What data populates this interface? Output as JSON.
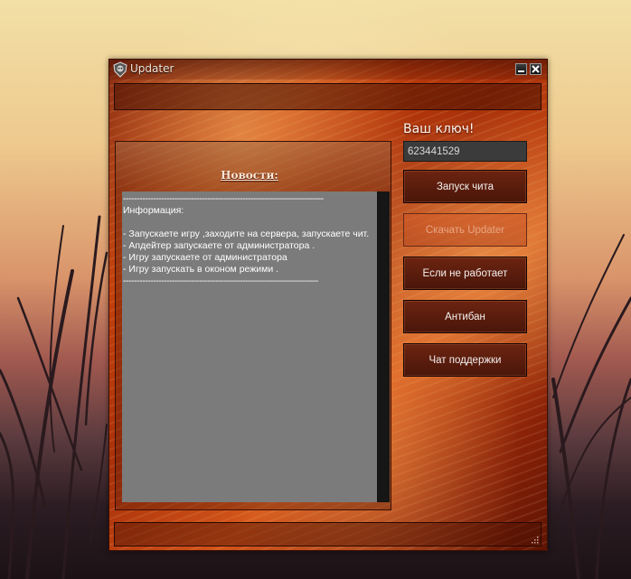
{
  "window": {
    "title": "Updater"
  },
  "news": {
    "title": "Новости:",
    "lines": [
      "--------------------------------------------------------------------------",
      "Информация:",
      "",
      "- Запускаете игру ,заходите на сервера, запускаете чит.",
      "- Апдейтер запускаете от администратора .",
      "- Игру запускаете от администратора",
      "- Игру запускать в оконом режими .",
      " ------------------------------------------------------------------------"
    ]
  },
  "key": {
    "label": "Ваш ключ!",
    "value": "623441529"
  },
  "buttons": {
    "launch_cheat": "Запуск чита",
    "download_updater": "Скачать Updater",
    "not_working": "Если не работает",
    "antiban": "Антибан",
    "support_chat": "Чат поддержки"
  },
  "colors": {
    "window_fire": "#c4400c",
    "button_bg": "#5a1c0c",
    "news_text_bg": "#7b7b7b"
  }
}
